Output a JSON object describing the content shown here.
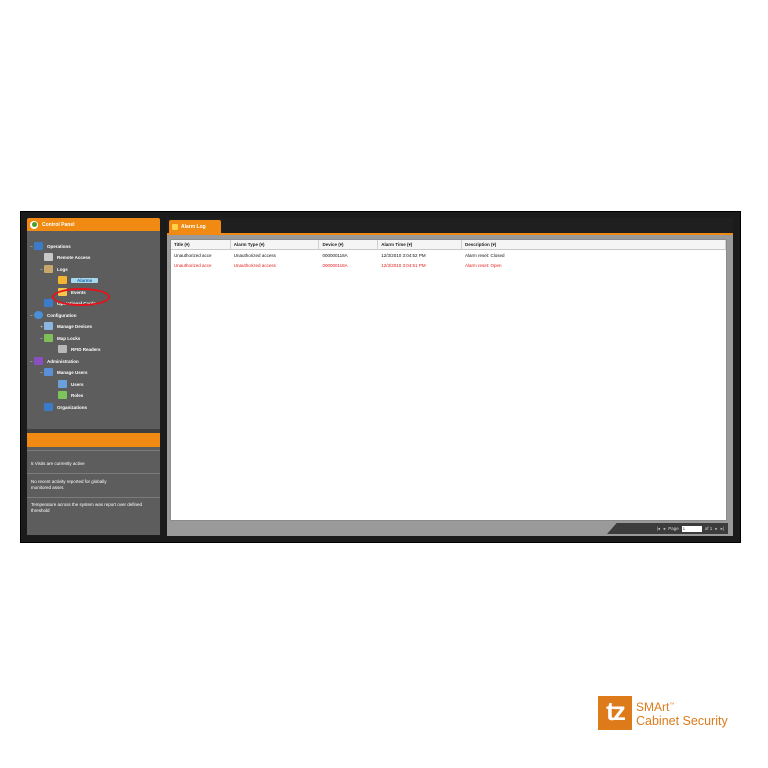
{
  "control_panel": {
    "title": "Control Panel",
    "tree": [
      {
        "label": "Operations",
        "icon": "operations-icon",
        "expander": "−"
      },
      {
        "label": "Remote Access",
        "icon": "remote-access-icon",
        "expander": ""
      },
      {
        "label": "Logs",
        "icon": "logs-icon",
        "expander": "−"
      },
      {
        "label": "Alarms",
        "icon": "alarm-icon",
        "expander": "",
        "selected": true
      },
      {
        "label": "Events",
        "icon": "events-icon",
        "expander": ""
      },
      {
        "label": "Operational Cards",
        "icon": "cards-icon",
        "expander": ""
      },
      {
        "label": "Configuration",
        "icon": "configuration-icon",
        "expander": "−"
      },
      {
        "label": "Manage Devices",
        "icon": "devices-icon",
        "expander": "+"
      },
      {
        "label": "Map Locks",
        "icon": "map-locks-icon",
        "expander": "−"
      },
      {
        "label": "RFID Readers",
        "icon": "rfid-icon",
        "expander": ""
      },
      {
        "label": "Administration",
        "icon": "administration-icon",
        "expander": "−"
      },
      {
        "label": "Manage Users",
        "icon": "users-group-icon",
        "expander": "−"
      },
      {
        "label": "Users",
        "icon": "user-icon",
        "expander": ""
      },
      {
        "label": "Roles",
        "icon": "roles-icon",
        "expander": ""
      },
      {
        "label": "Organizations",
        "icon": "organizations-icon",
        "expander": ""
      }
    ],
    "alerts": [
      "5 Visits are currently active",
      "No recent activity reported for globally monitored asset.",
      "Temperature across the system was report over defined threshold"
    ]
  },
  "alarm_log": {
    "tab_label": "Alarm Log",
    "columns": [
      "Title (▾)",
      "Alarm Type (▾)",
      "Device (▾)",
      "Alarm Time (▾)",
      "Description (▾)"
    ],
    "rows": [
      [
        "Unauthorized acce",
        "Unauthorized access",
        "000000118A",
        "12/3/2010 3:04:52 PM",
        "Alarm reset: Closed"
      ],
      [
        "Unauthorized acce",
        "Unauthorized access",
        "000000118A",
        "12/3/2010 3:04:51 PM",
        "Alarm reset: Open"
      ]
    ],
    "pager": {
      "first": "|◂",
      "prev": "◂",
      "page_label": "Page",
      "page_value": "1",
      "of_label": "of 1",
      "next": "▸",
      "last": "▸|"
    }
  },
  "logo": {
    "mark": "tz",
    "line1": "SMArt",
    "tm": "™",
    "line2": "Cabinet Security"
  },
  "colors": {
    "accent": "#f08a12",
    "alert_row": "#e32020",
    "logo": "#dd7b1b"
  }
}
